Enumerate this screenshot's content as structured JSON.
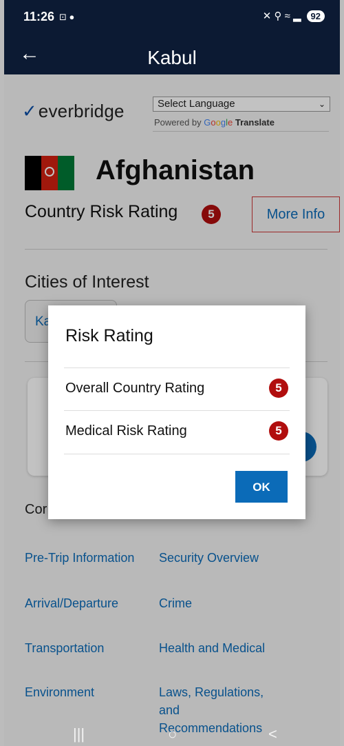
{
  "status_bar": {
    "time": "11:26",
    "small_icons": "⊡ ●",
    "right_icons": "✕ ⚲ ≈ ▂",
    "battery": "92"
  },
  "app_bar": {
    "back": "←",
    "title": "Kabul"
  },
  "logo": {
    "mark": "✓",
    "text": "everbridge"
  },
  "language": {
    "select_label": "Select Language",
    "powered_by": "Powered by",
    "google": [
      "G",
      "o",
      "o",
      "g",
      "l",
      "e"
    ],
    "translate": "Translate"
  },
  "country": {
    "name": "Afghanistan",
    "risk_label": "Country Risk Rating",
    "risk_value": "5",
    "more_info": "More Info"
  },
  "cities": {
    "title": "Cities of Interest",
    "chip": "Ka"
  },
  "contents_label": "Cor",
  "links": [
    "Pre-Trip Information",
    "Security Overview",
    "Arrival/Departure",
    "Crime",
    "Transportation",
    "Health and Medical",
    "Environment",
    "Laws, Regulations, and Recommendations"
  ],
  "nav": {
    "recents": "|||",
    "home": "○",
    "back": "<"
  },
  "dialog": {
    "title": "Risk Rating",
    "rows": [
      {
        "label": "Overall Country Rating",
        "value": "5"
      },
      {
        "label": "Medical Risk Rating",
        "value": "5"
      }
    ],
    "ok": "OK"
  },
  "colors": {
    "navy": "#0c1a33",
    "link_blue": "#0b6bb8",
    "badge_red": "#b10e0e"
  }
}
